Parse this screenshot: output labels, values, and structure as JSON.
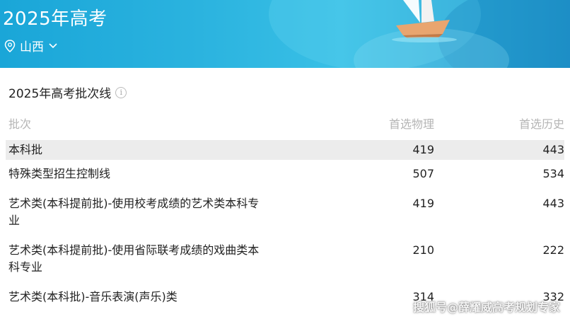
{
  "banner": {
    "title": "2025年高考",
    "location": "山西"
  },
  "section": {
    "title": "2025年高考批次线"
  },
  "table": {
    "headers": [
      "批次",
      "首选物理",
      "首选历史"
    ],
    "rows": [
      {
        "batch": "本科批",
        "physics": "419",
        "history": "443"
      },
      {
        "batch": "特殊类型招生控制线",
        "physics": "507",
        "history": "534"
      },
      {
        "batch_line1": "艺术类(本科提前批)-使用校考成绩的艺术类本科专",
        "batch_line2": "业",
        "physics": "419",
        "history": "443"
      },
      {
        "batch_line1": "艺术类(本科提前批)-使用省际联考成绩的戏曲类本",
        "batch_line2": "科专业",
        "physics": "210",
        "history": "222"
      },
      {
        "batch": "艺术类(本科批)-音乐表演(声乐)类",
        "physics": "314",
        "history": "332"
      }
    ]
  },
  "watermark": "搜狐号@薛耀威高考规划专家"
}
